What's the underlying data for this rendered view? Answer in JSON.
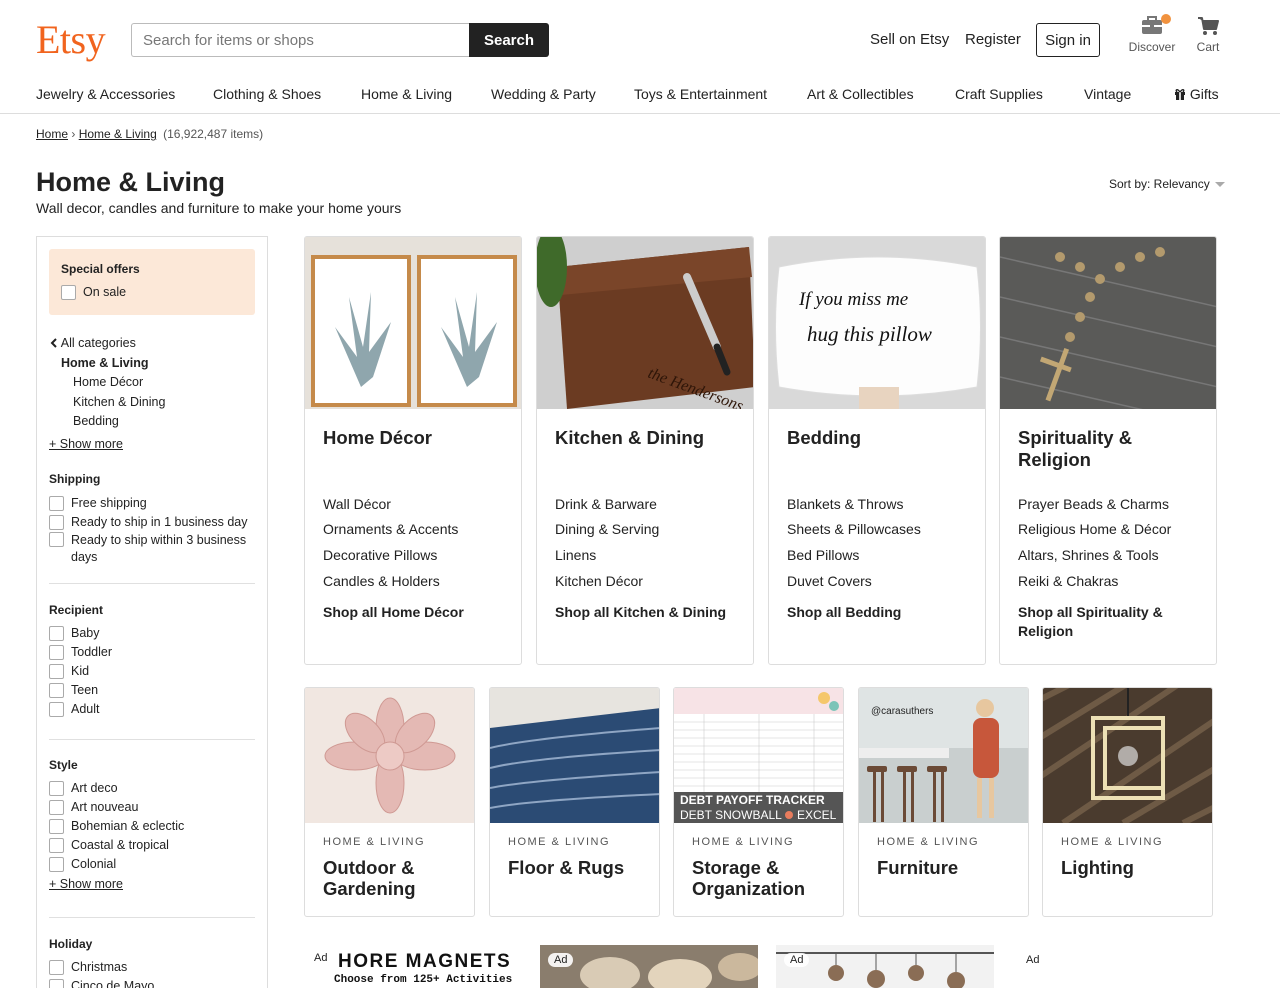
{
  "header": {
    "logo": "Etsy",
    "search_placeholder": "Search for items or shops",
    "search_button": "Search",
    "sell_link": "Sell on Etsy",
    "register_link": "Register",
    "signin_button": "Sign in",
    "discover_label": "Discover",
    "cart_label": "Cart"
  },
  "catnav": {
    "items": [
      "Jewelry & Accessories",
      "Clothing & Shoes",
      "Home & Living",
      "Wedding & Party",
      "Toys & Entertainment",
      "Art & Collectibles",
      "Craft Supplies",
      "Vintage"
    ],
    "gifts": "Gifts"
  },
  "breadcrumb": {
    "home": "Home",
    "current": "Home & Living",
    "count": "(16,922,487 items)"
  },
  "page": {
    "title": "Home & Living",
    "subtitle": "Wall decor, candles and furniture to make your home yours",
    "sort_label": "Sort by: Relevancy"
  },
  "sidebar": {
    "special_offers": {
      "heading": "Special offers",
      "on_sale": "On sale"
    },
    "categories": {
      "all": "All categories",
      "current": "Home & Living",
      "children": [
        "Home Décor",
        "Kitchen & Dining",
        "Bedding"
      ],
      "show_more": "+ Show more"
    },
    "shipping": {
      "heading": "Shipping",
      "options": [
        "Free shipping",
        "Ready to ship in 1 business day",
        "Ready to ship within 3 business days"
      ]
    },
    "recipient": {
      "heading": "Recipient",
      "options": [
        "Baby",
        "Toddler",
        "Kid",
        "Teen",
        "Adult"
      ]
    },
    "style": {
      "heading": "Style",
      "options": [
        "Art deco",
        "Art nouveau",
        "Bohemian & eclectic",
        "Coastal & tropical",
        "Colonial"
      ],
      "show_more": "+ Show more"
    },
    "holiday": {
      "heading": "Holiday",
      "options": [
        "Christmas",
        "Cinco de Mayo"
      ]
    }
  },
  "feature_cards": [
    {
      "title": "Home Décor",
      "links": [
        "Wall Décor",
        "Ornaments & Accents",
        "Decorative Pillows",
        "Candles & Holders"
      ],
      "shop_all": "Shop all Home Décor"
    },
    {
      "title": "Kitchen & Dining",
      "links": [
        "Drink & Barware",
        "Dining & Serving",
        "Linens",
        "Kitchen Décor"
      ],
      "shop_all": "Shop all Kitchen & Dining",
      "image_text": "the Hendersons"
    },
    {
      "title": "Bedding",
      "links": [
        "Blankets & Throws",
        "Sheets & Pillowcases",
        "Bed Pillows",
        "Duvet Covers"
      ],
      "shop_all": "Shop all Bedding",
      "image_text_1": "If you miss me",
      "image_text_2": "hug this pillow"
    },
    {
      "title": "Spirituality & Religion",
      "links": [
        "Prayer Beads & Charms",
        "Religious Home & Décor",
        "Altars, Shrines & Tools",
        "Reiki & Chakras"
      ],
      "shop_all": "Shop all Spirituality & Religion"
    }
  ],
  "sub_cards": [
    {
      "eyebrow": "HOME & LIVING",
      "title": "Outdoor & Gardening"
    },
    {
      "eyebrow": "HOME & LIVING",
      "title": "Floor & Rugs"
    },
    {
      "eyebrow": "HOME & LIVING",
      "title": "Storage & Organization",
      "image_text_1": "DEBT PAYOFF TRACKER",
      "image_text_2": "DEBT SNOWBALL",
      "image_text_3": "EXCEL"
    },
    {
      "eyebrow": "HOME & LIVING",
      "title": "Furniture",
      "image_text": "@carasuthers"
    },
    {
      "eyebrow": "HOME & LIVING",
      "title": "Lighting"
    }
  ],
  "ads": {
    "badge": "Ad",
    "ad1_line1": "HORE MAGNETS",
    "ad1_line2": "Choose from 125+ Activities"
  },
  "colors": {
    "brand": "#F1641E",
    "special_bg": "#FCE8D8",
    "dark_button": "#222222",
    "notif": "#F1923E"
  }
}
